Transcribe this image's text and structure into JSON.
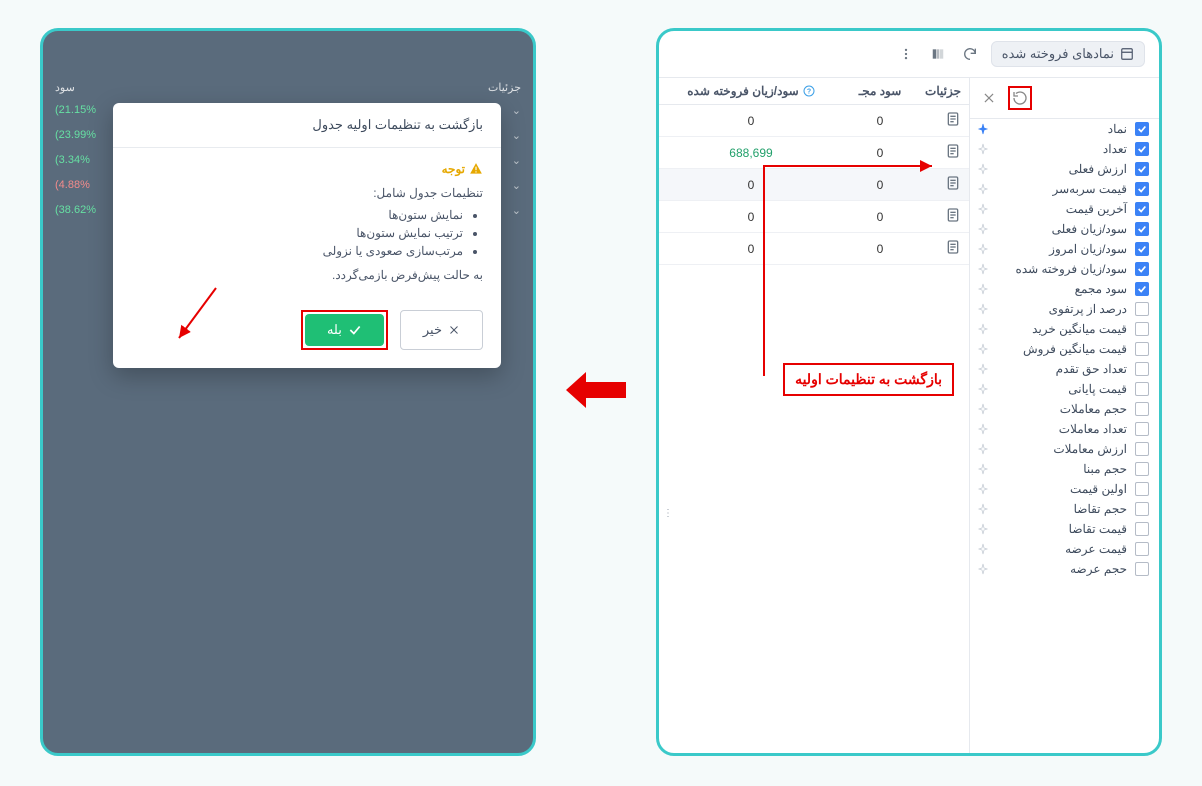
{
  "topbar": {
    "chip_label": "نمادهای فروخته شده"
  },
  "table_header": {
    "details": "جزئیات",
    "profit_label": "سود مجـ",
    "sold_pl": "سود/زیان فروخته شده"
  },
  "table_rows": [
    {
      "details_icon": "doc",
      "profit": "0",
      "sold_pl": "0"
    },
    {
      "details_icon": "doc",
      "profit": "0",
      "sold_pl": "688,699",
      "green": true
    },
    {
      "details_icon": "doc",
      "profit": "0",
      "sold_pl": "0"
    },
    {
      "details_icon": "doc",
      "profit": "0",
      "sold_pl": "0"
    },
    {
      "details_icon": "doc",
      "profit": "0",
      "sold_pl": "0"
    }
  ],
  "columns": [
    {
      "label": "نماد",
      "checked": true,
      "pinned": true
    },
    {
      "label": "تعداد",
      "checked": true,
      "pinned": false
    },
    {
      "label": "ارزش فعلی",
      "checked": true,
      "pinned": false
    },
    {
      "label": "قیمت سربه‌سر",
      "checked": true,
      "pinned": false
    },
    {
      "label": "آخرین قیمت",
      "checked": true,
      "pinned": false
    },
    {
      "label": "سود/زیان فعلی",
      "checked": true,
      "pinned": false
    },
    {
      "label": "سود/زیان امروز",
      "checked": true,
      "pinned": false
    },
    {
      "label": "سود/زیان فروخته شده",
      "checked": true,
      "pinned": false
    },
    {
      "label": "سود مجمع",
      "checked": true,
      "pinned": false
    },
    {
      "label": "درصد از پرتفوی",
      "checked": false,
      "pinned": false
    },
    {
      "label": "قیمت میانگین خرید",
      "checked": false,
      "pinned": false
    },
    {
      "label": "قیمت میانگین فروش",
      "checked": false,
      "pinned": false
    },
    {
      "label": "تعداد حق تقدم",
      "checked": false,
      "pinned": false
    },
    {
      "label": "قیمت پایانی",
      "checked": false,
      "pinned": false
    },
    {
      "label": "حجم معاملات",
      "checked": false,
      "pinned": false
    },
    {
      "label": "تعداد معاملات",
      "checked": false,
      "pinned": false
    },
    {
      "label": "ارزش معاملات",
      "checked": false,
      "pinned": false
    },
    {
      "label": "حجم مبنا",
      "checked": false,
      "pinned": false
    },
    {
      "label": "اولین قیمت",
      "checked": false,
      "pinned": false
    },
    {
      "label": "حجم تقاضا",
      "checked": false,
      "pinned": false
    },
    {
      "label": "قیمت تقاضا",
      "checked": false,
      "pinned": false
    },
    {
      "label": "قیمت عرضه",
      "checked": false,
      "pinned": false
    },
    {
      "label": "حجم عرضه",
      "checked": false,
      "pinned": false
    }
  ],
  "annotation": {
    "label": "بازگشت به تنظیمات اولیه"
  },
  "bg_table": {
    "header_left": "جزئیات",
    "header_right": "سود",
    "rows": [
      {
        "pct": "21.15%)",
        "cls": "green"
      },
      {
        "pct": "23.99%)",
        "cls": "green"
      },
      {
        "pct": "3.34%)",
        "cls": "green"
      },
      {
        "pct": "4.88%)",
        "cls": "red"
      },
      {
        "pct": "38.62%)",
        "cls": "green"
      }
    ]
  },
  "modal": {
    "title": "بازگشت به تنظیمات اولیه جدول",
    "warn": "توجه",
    "intro": "تنظیمات جدول شامل:",
    "items": [
      "نمایش ستون‌ها",
      "ترتیب نمایش ستون‌ها",
      "مرتب‌سازی صعودی یا نزولی"
    ],
    "footer": "به حالت پیش‌فرض بازمی‌گردد.",
    "yes": "بله",
    "no": "خیر"
  },
  "colors": {
    "accent": "#3ac9c9",
    "red": "#e60000",
    "green_btn": "#1fbf75"
  }
}
